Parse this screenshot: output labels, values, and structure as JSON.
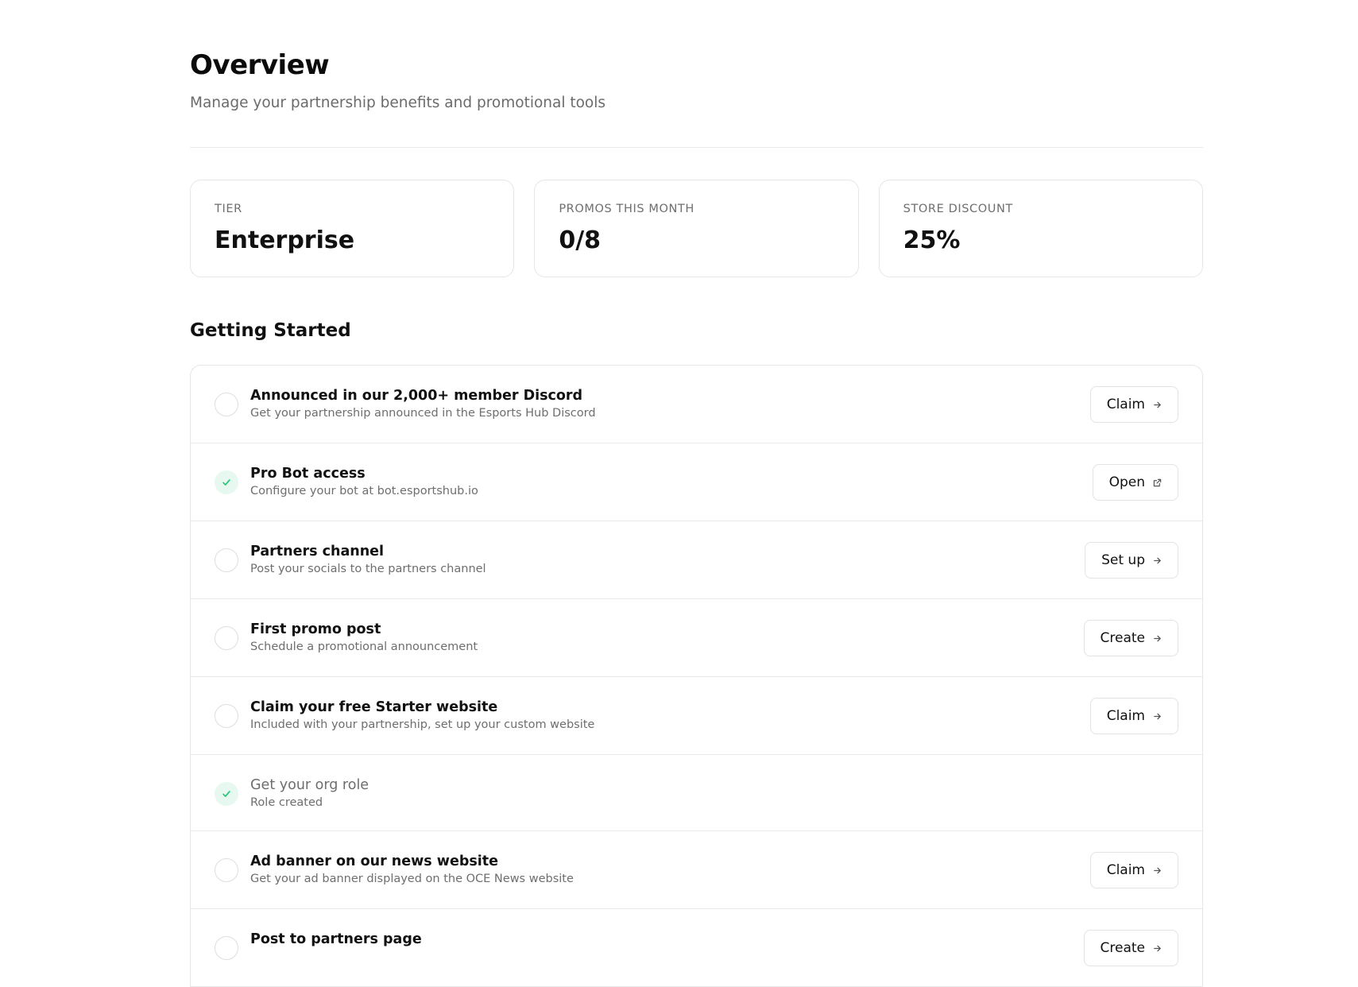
{
  "header": {
    "title": "Overview",
    "subtitle": "Manage your partnership benefits and promotional tools"
  },
  "stats": [
    {
      "label": "TIER",
      "value": "Enterprise"
    },
    {
      "label": "PROMOS THIS MONTH",
      "value": "0/8"
    },
    {
      "label": "STORE DISCOUNT",
      "value": "25%"
    }
  ],
  "getting_started": {
    "title": "Getting Started",
    "items": [
      {
        "title": "Announced in our 2,000+ member Discord",
        "description": "Get your partnership announced in the Esports Hub Discord",
        "done": false,
        "action": "Claim",
        "action_icon": "arrow-right-icon"
      },
      {
        "title": "Pro Bot access",
        "description": "Configure your bot at bot.esportshub.io",
        "done": true,
        "action": "Open",
        "action_icon": "external-link-icon"
      },
      {
        "title": "Partners channel",
        "description": "Post your socials to the partners channel",
        "done": false,
        "action": "Set up",
        "action_icon": "arrow-right-icon"
      },
      {
        "title": "First promo post",
        "description": "Schedule a promotional announcement",
        "done": false,
        "action": "Create",
        "action_icon": "arrow-right-icon"
      },
      {
        "title": "Claim your free Starter website",
        "description": "Included with your partnership, set up your custom website",
        "done": false,
        "action": "Claim",
        "action_icon": "arrow-right-icon"
      },
      {
        "title": "Get your org role",
        "description": "Role created",
        "done": true,
        "action": null,
        "action_icon": null
      },
      {
        "title": "Ad banner on our news website",
        "description": "Get your ad banner displayed on the OCE News website",
        "done": false,
        "action": "Claim",
        "action_icon": "arrow-right-icon"
      },
      {
        "title": "Post to partners page",
        "description": "",
        "done": false,
        "action": "Create",
        "action_icon": "arrow-right-icon"
      }
    ]
  },
  "colors": {
    "check_green": "#22c07a",
    "check_bg": "#e6f8ef",
    "border": "#e6e6e6",
    "muted_text": "#6e6e6e"
  }
}
